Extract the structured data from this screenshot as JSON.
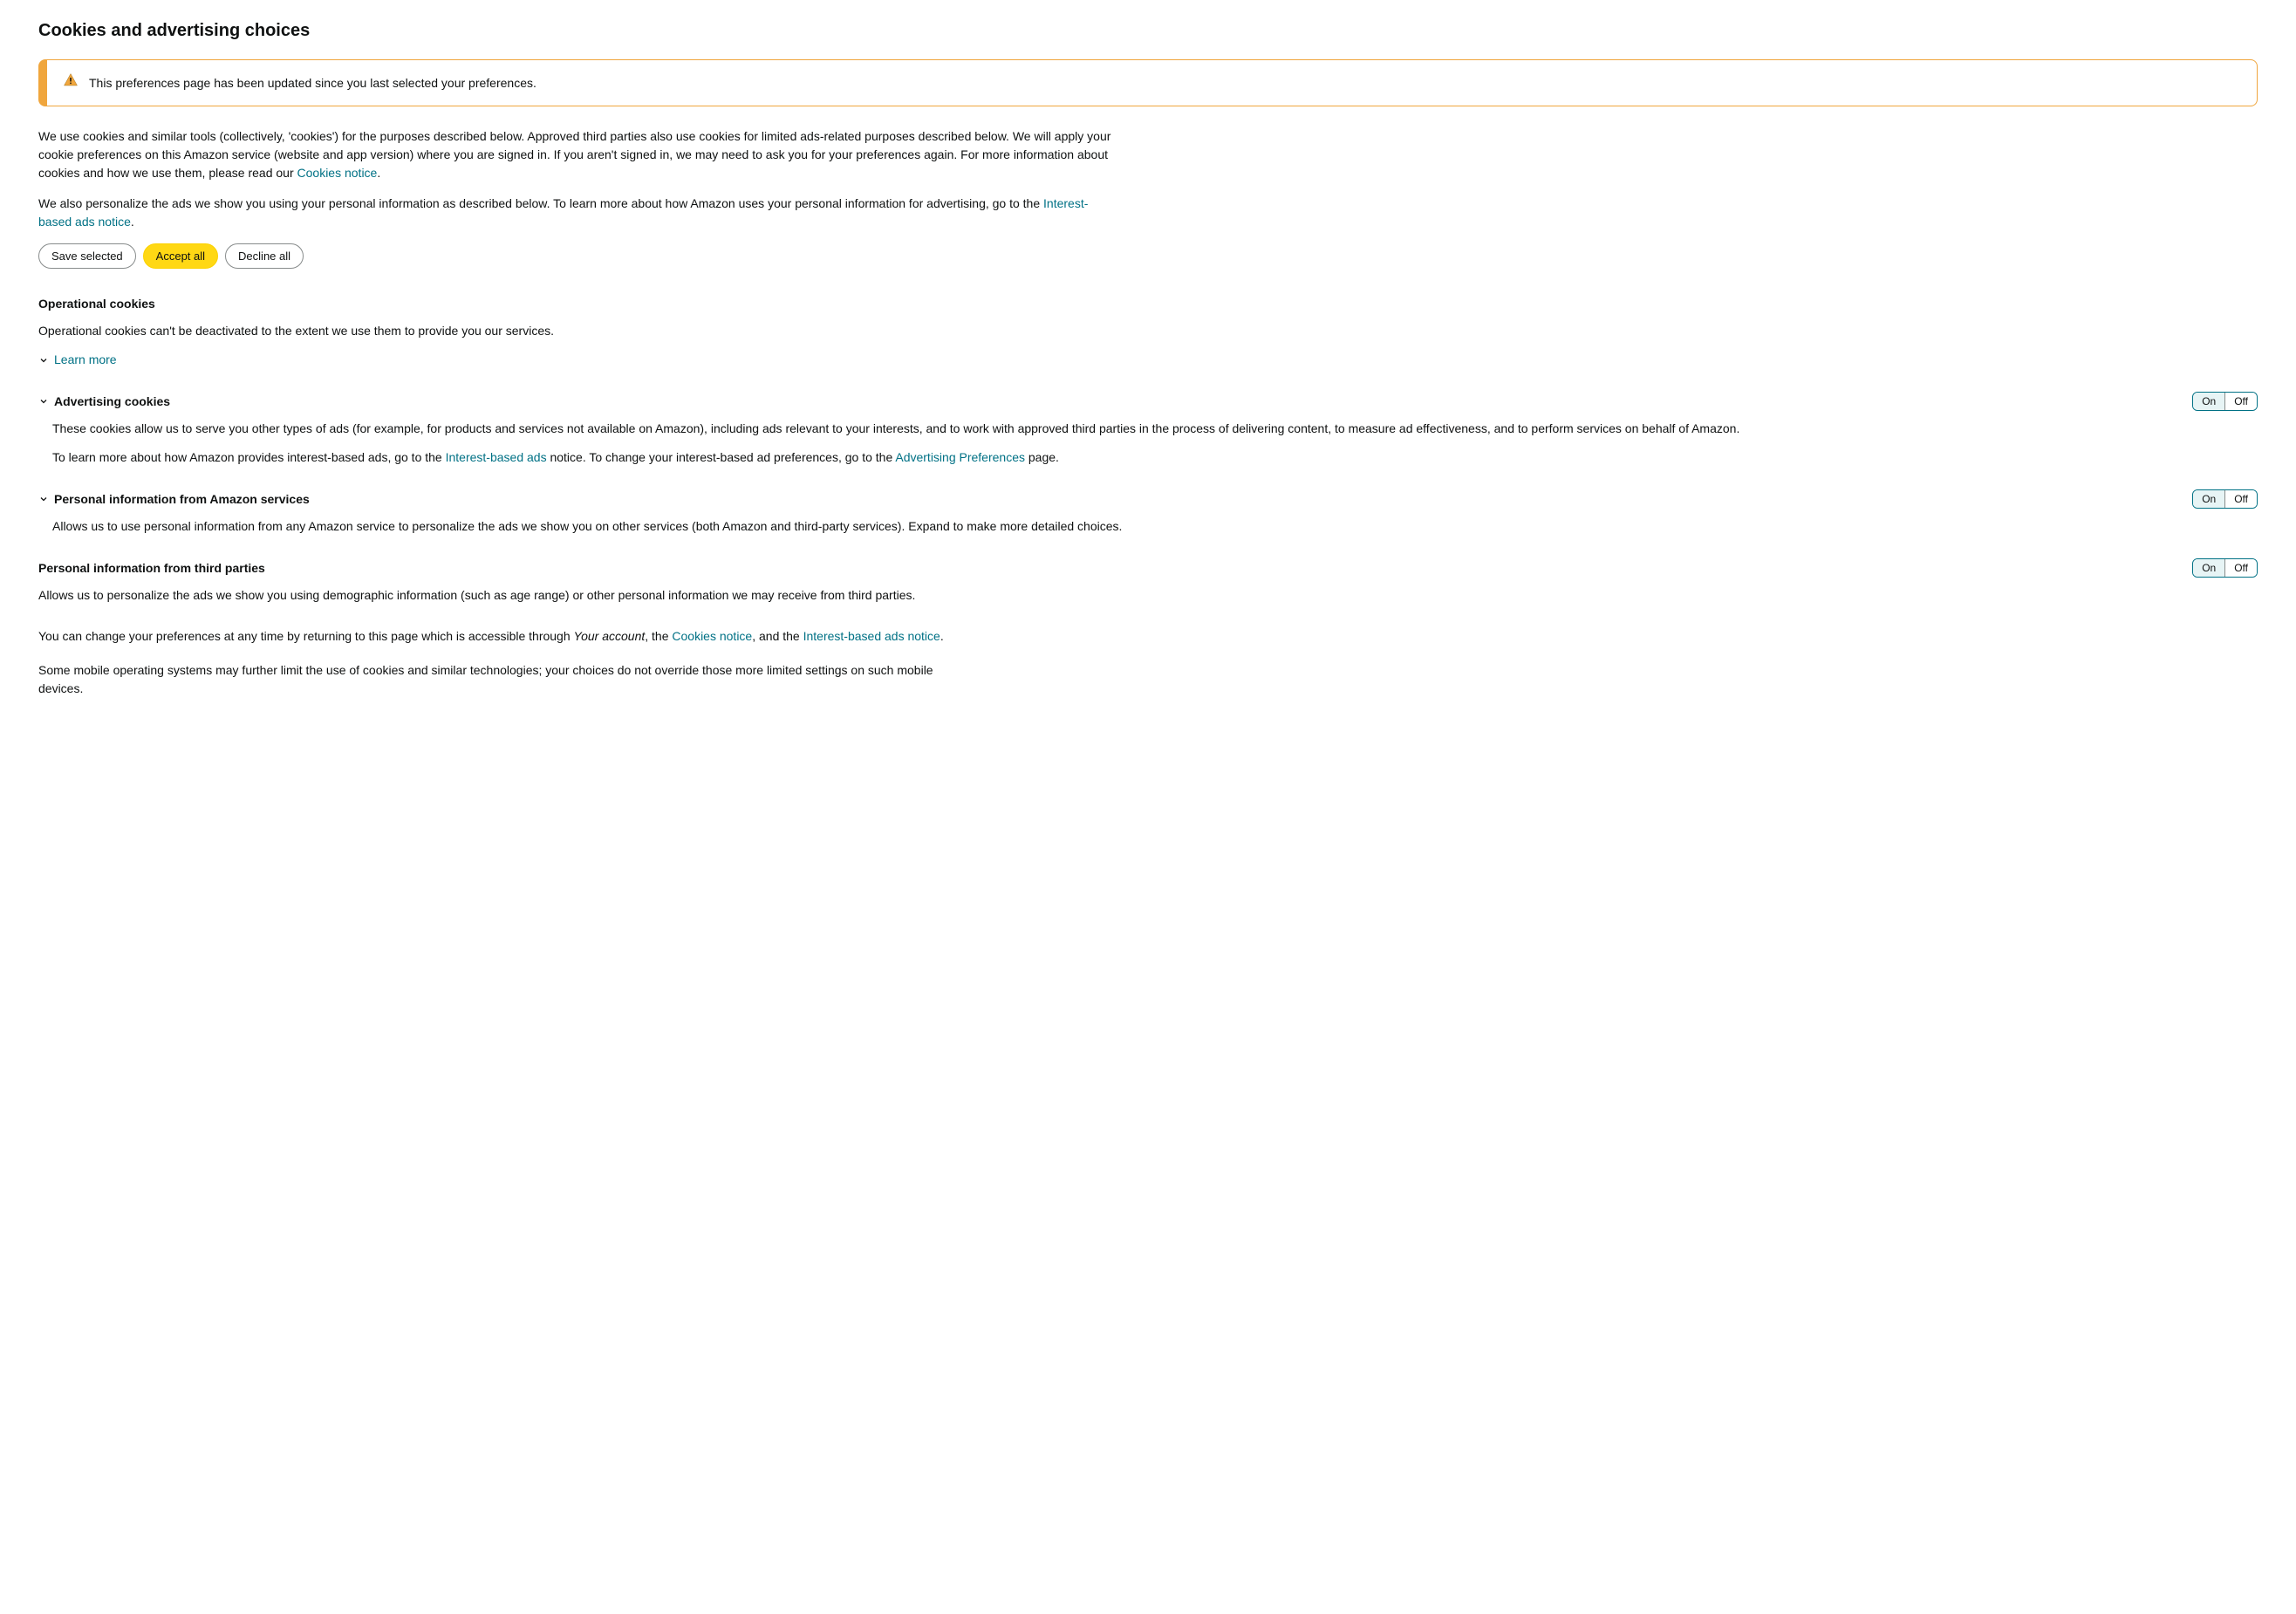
{
  "page": {
    "title": "Cookies and advertising choices"
  },
  "alert": {
    "message": "This preferences page has been updated since you last selected your preferences."
  },
  "intro": {
    "para1_pre": "We use cookies and similar tools (collectively, 'cookies') for the purposes described below. Approved third parties also use cookies for limited ads-related purposes described below. We will apply your cookie preferences on this Amazon service (website and app version) where you are signed in. If you aren't signed in, we may need to ask you for your preferences again. For more information about cookies and how we use them, please read our ",
    "cookies_notice_link": "Cookies notice",
    "para1_post": ".",
    "para2_pre": "We also personalize the ads we show you using your personal information as described below. To learn more about how Amazon uses your personal information for advertising, go to the ",
    "interest_link": "Interest-based ads notice",
    "para2_post": "."
  },
  "buttons": {
    "save_selected": "Save selected",
    "accept_all": "Accept all",
    "decline_all": "Decline all"
  },
  "toggle_labels": {
    "on": "On",
    "off": "Off"
  },
  "sections": {
    "operational": {
      "title": "Operational cookies",
      "body": "Operational cookies can't be deactivated to the extent we use them to provide you our services.",
      "learn_more": "Learn more"
    },
    "advertising": {
      "title": "Advertising cookies",
      "body1": "These cookies allow us to serve you other types of ads (for example, for products and services not available on Amazon), including ads relevant to your interests, and to work with approved third parties in the process of delivering content, to measure ad effectiveness, and to perform services on behalf of Amazon.",
      "body2_pre": "To learn more about how Amazon provides interest-based ads, go to the ",
      "link1": "Interest-based ads",
      "body2_mid": " notice. To change your interest-based ad preferences, go to the ",
      "link2": "Advertising Preferences",
      "body2_post": " page."
    },
    "personal_amazon": {
      "title": "Personal information from Amazon services",
      "body": "Allows us to use personal information from any Amazon service to personalize the ads we show you on other services (both Amazon and third-party services). Expand to make more detailed choices."
    },
    "personal_third": {
      "title": "Personal information from third parties",
      "body": "Allows us to personalize the ads we show you using demographic information (such as age range) or other personal information we may receive from third parties."
    }
  },
  "footer": {
    "para1_pre": "You can change your preferences at any time by returning to this page which is accessible through ",
    "your_account": "Your account",
    "para1_mid1": ", the ",
    "link_cookies": "Cookies notice",
    "para1_mid2": ", and the ",
    "link_interest": "Interest-based ads notice",
    "para1_post": ".",
    "para2": "Some mobile operating systems may further limit the use of cookies and similar technologies; your choices do not override those more limited settings on such mobile devices."
  }
}
